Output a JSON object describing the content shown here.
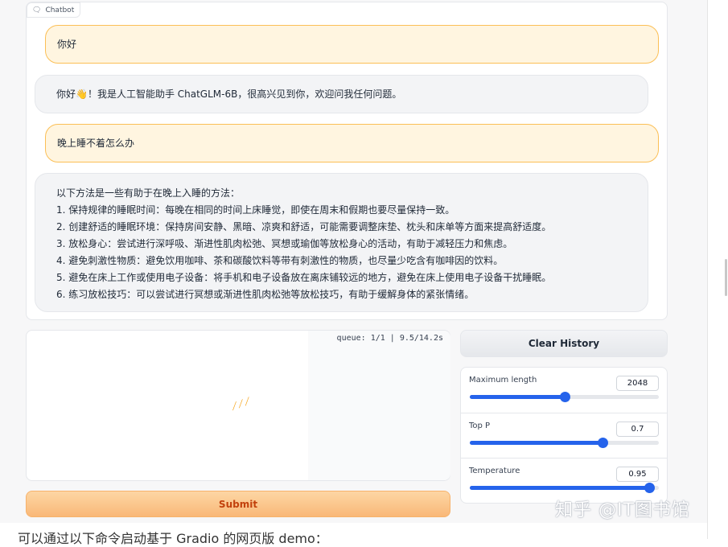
{
  "chatbot": {
    "label": "Chatbot",
    "messages": [
      {
        "role": "user",
        "text": "你好"
      },
      {
        "role": "bot",
        "text": "你好👋！我是人工智能助手 ChatGLM-6B，很高兴见到你，欢迎问我任何问题。"
      },
      {
        "role": "user",
        "text": "晚上睡不着怎么办"
      },
      {
        "role": "bot",
        "lines": [
          "以下方法是一些有助于在晚上入睡的方法：",
          "1. 保持规律的睡眠时间：每晚在相同的时间上床睡觉，即使在周末和假期也要尽量保持一致。",
          "2. 创建舒适的睡眠环境：保持房间安静、黑暗、凉爽和舒适，可能需要调整床垫、枕头和床单等方面来提高舒适度。",
          "3. 放松身心：尝试进行深呼吸、渐进性肌肉松弛、冥想或瑜伽等放松身心的活动，有助于减轻压力和焦虑。",
          "4. 避免刺激性物质：避免饮用咖啡、茶和碳酸饮料等带有刺激性的物质，也尽量少吃含有咖啡因的饮料。",
          "5. 避免在床上工作或使用电子设备：将手机和电子设备放在离床铺较远的地方，避免在床上使用电子设备干扰睡眠。",
          "6. 练习放松技巧：可以尝试进行冥想或渐进性肌肉松弛等放松技巧，有助于缓解身体的紧张情绪。"
        ]
      }
    ]
  },
  "input": {
    "queue_status": "queue: 1/1 | 9.5/14.2s"
  },
  "buttons": {
    "submit": "Submit",
    "clear": "Clear History"
  },
  "sliders": [
    {
      "label": "Maximum length",
      "value": "2048",
      "fraction": 0.5
    },
    {
      "label": "Top P",
      "value": "0.7",
      "fraction": 0.7
    },
    {
      "label": "Temperature",
      "value": "0.95",
      "fraction": 0.95
    }
  ],
  "watermark": "知乎 @IT图书馆",
  "bottom_text": "可以通过以下命令启动基于 Gradio 的网页版 demo：",
  "colors": {
    "accent": "#2563eb",
    "user_bubble": "#fff5e0",
    "user_border": "#fbbf56",
    "bot_bubble": "#f3f4f6",
    "submit_text": "#c2410c"
  }
}
